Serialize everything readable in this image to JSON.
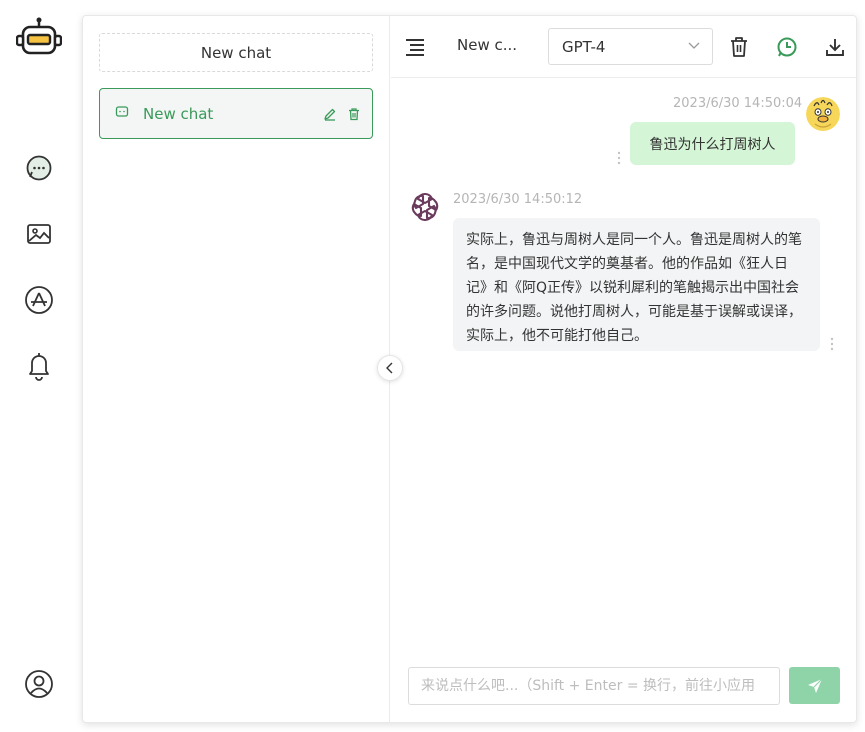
{
  "rail": {
    "logo_icon": "robot-icon",
    "nav_icons": [
      "chat-icon",
      "image-icon",
      "app-store-icon",
      "bell-icon"
    ],
    "user_icon": "user-circle-icon"
  },
  "sidebar": {
    "new_chat_label": "New chat",
    "conversations": [
      {
        "label": "New chat",
        "selected": true
      }
    ]
  },
  "header": {
    "title": "New c...",
    "model": "GPT-4"
  },
  "messages": [
    {
      "role": "user",
      "time": "2023/6/30 14:50:04",
      "text": "鲁迅为什么打周树人"
    },
    {
      "role": "assistant",
      "time": "2023/6/30 14:50:12",
      "text": "实际上，鲁迅与周树人是同一个人。鲁迅是周树人的笔名，是中国现代文学的奠基者。他的作品如《狂人日记》和《阿Q正传》以锐利犀利的笔触揭示出中国社会的许多问题。说他打周树人，可能是基于误解或误译，实际上，他不可能打他自己。"
    }
  ],
  "input": {
    "placeholder": "来说点什么吧...（Shift + Enter = 换行，前往小应用",
    "value": ""
  },
  "colors": {
    "accent": "#3a9a5a",
    "user_bubble": "#d4f5d6",
    "bot_bubble": "#f3f4f6",
    "send_button": "#8fd4a8"
  }
}
